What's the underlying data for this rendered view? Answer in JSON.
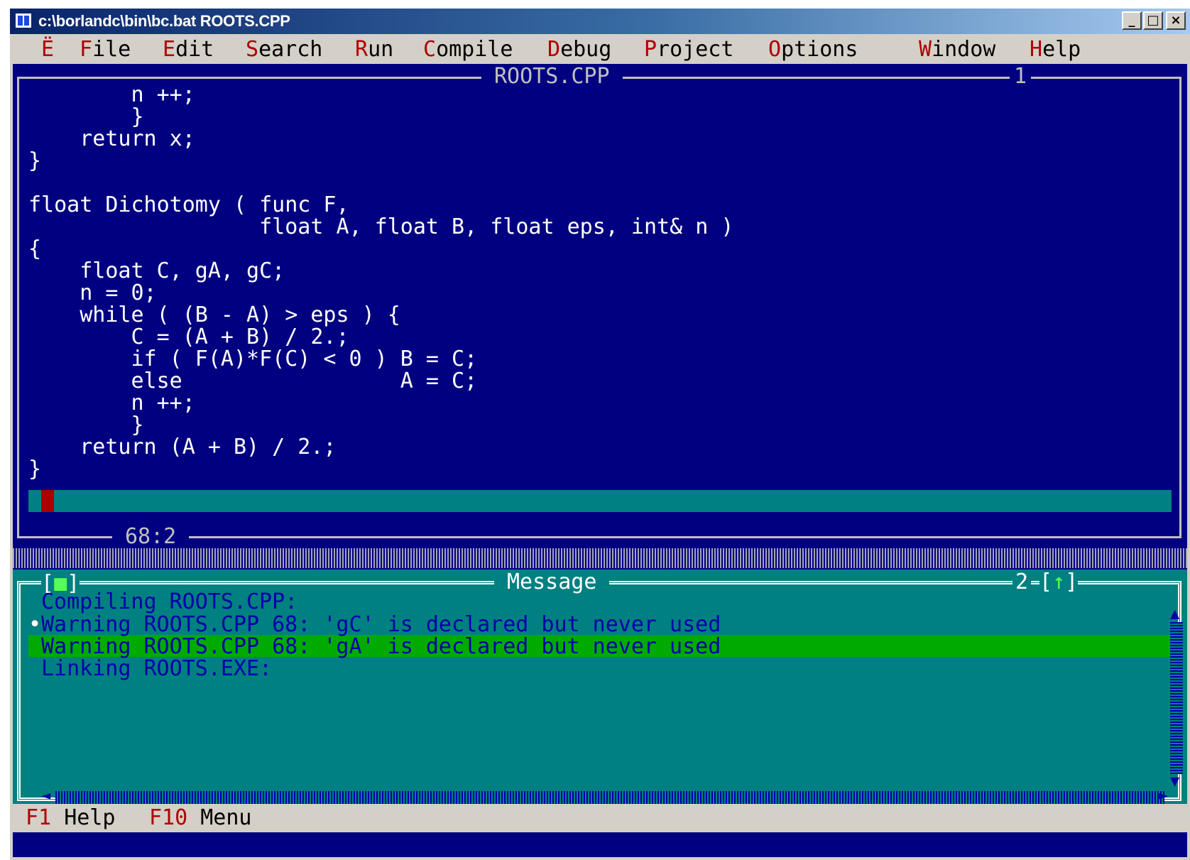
{
  "window": {
    "title": "c:\\borlandc\\bin\\bc.bat ROOTS.CPP",
    "controls": {
      "minimize": "_",
      "maximize": "□",
      "close": "×"
    }
  },
  "menu": {
    "system": "Ë",
    "items": [
      {
        "hot": "F",
        "rest": "ile"
      },
      {
        "hot": "E",
        "rest": "dit"
      },
      {
        "hot": "S",
        "rest": "earch"
      },
      {
        "hot": "R",
        "rest": "un"
      },
      {
        "hot": "C",
        "rest": "ompile"
      },
      {
        "hot": "D",
        "rest": "ebug"
      },
      {
        "hot": "P",
        "rest": "roject"
      },
      {
        "hot": "O",
        "rest": "ptions"
      },
      {
        "hot": "W",
        "rest": "indow"
      },
      {
        "hot": "H",
        "rest": "elp"
      }
    ]
  },
  "editor": {
    "title": "ROOTS.CPP",
    "window_number": "1",
    "cursor_position": "68:2",
    "code_lines": [
      "        n ++;",
      "        }",
      "    return x;",
      "}",
      "",
      "float Dichotomy ( func F,",
      "                  float A, float B, float eps, int& n )",
      "{",
      "    float C, gA, gC;",
      "    n = 0;",
      "    while ( (B - A) > eps ) {",
      "        C = (A + B) / 2.;",
      "        if ( F(A)*F(C) < 0 ) B = C;",
      "        else                 A = C;",
      "        n ++;",
      "        }",
      "    return (A + B) / 2.;",
      "}"
    ]
  },
  "message": {
    "title": "Message",
    "window_number": "2",
    "lines": [
      "Compiling ROOTS.CPP:",
      "Warning ROOTS.CPP 68: 'gC' is declared but never used",
      "Warning ROOTS.CPP 68: 'gA' is declared but never used",
      "Linking ROOTS.EXE:"
    ],
    "selected_index": 1,
    "bullet": "•"
  },
  "status": {
    "items": [
      {
        "key": "F1",
        "label": "Help"
      },
      {
        "key": "F10",
        "label": "Menu"
      }
    ]
  }
}
